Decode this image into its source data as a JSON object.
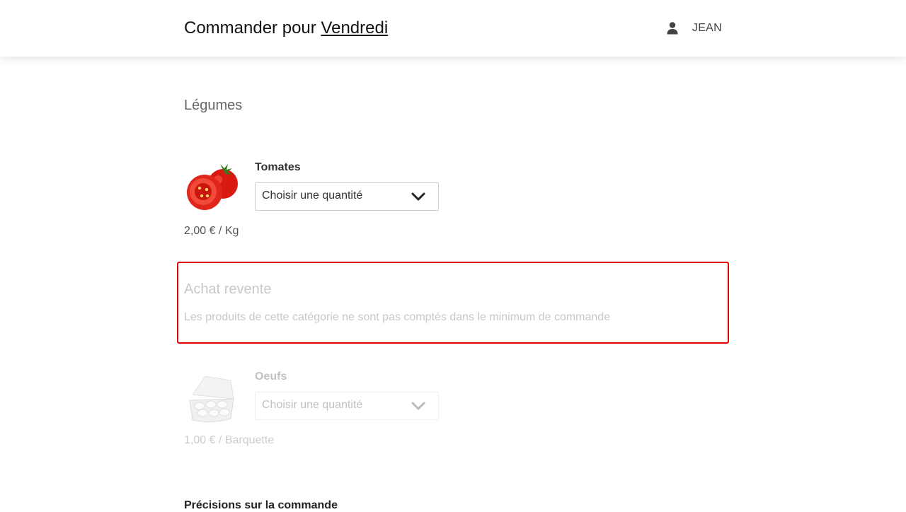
{
  "header": {
    "title_prefix": "Commander pour",
    "day": "Vendredi",
    "user_name": "JEAN",
    "user_icon": "user-icon"
  },
  "categories": [
    {
      "title": "Légumes",
      "products": [
        {
          "name": "Tomates",
          "image_icon": "tomato-image",
          "quantity_placeholder": "Choisir une quantité",
          "price": "2,00 € / Kg"
        }
      ]
    },
    {
      "title": "Achat revente",
      "notice": "Les produits de cette catégorie ne sont pas comptés dans le minimum de commande",
      "products": [
        {
          "name": "Oeufs",
          "image_icon": "egg-carton-image",
          "quantity_placeholder": "Choisir une quantité",
          "price": "1,00 € / Barquette"
        }
      ]
    }
  ],
  "order_details": {
    "title": "Précisions sur la commande"
  },
  "colors": {
    "highlight_border": "#e00000",
    "text": "#333333"
  }
}
